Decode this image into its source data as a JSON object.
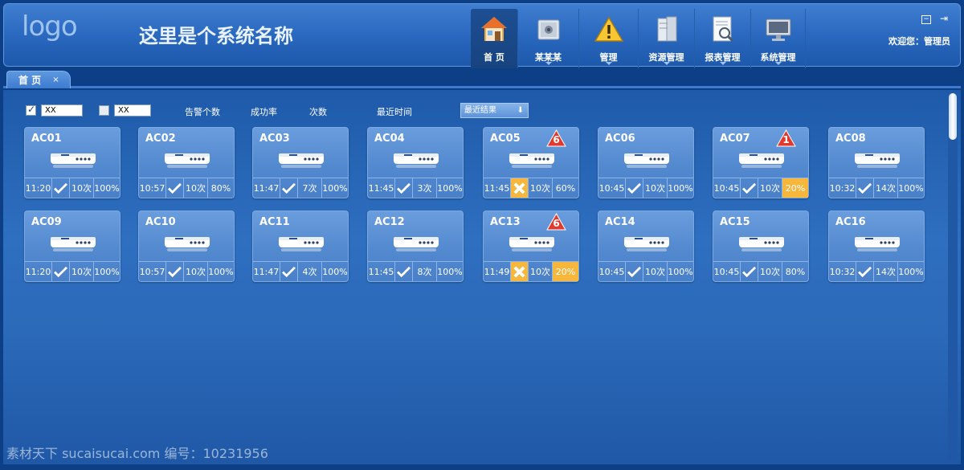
{
  "header": {
    "logo": "logo",
    "system_name": "这里是个系统名称",
    "welcome": "欢迎您：管理员",
    "nav": [
      {
        "label": "首 页",
        "icon": "home-icon",
        "active": true,
        "arrow": false
      },
      {
        "label": "某某某",
        "icon": "safe-icon",
        "active": false,
        "arrow": true
      },
      {
        "label": "管理",
        "icon": "warning-icon",
        "active": false,
        "arrow": true
      },
      {
        "label": "资源管理",
        "icon": "server-icon",
        "active": false,
        "arrow": true
      },
      {
        "label": "报表管理",
        "icon": "report-search-icon",
        "active": false,
        "arrow": true
      },
      {
        "label": "系统管理",
        "icon": "monitor-icon",
        "active": false,
        "arrow": true
      }
    ]
  },
  "tabs": [
    {
      "label": "首 页",
      "close": "×"
    }
  ],
  "filters": {
    "check1": {
      "checked": true,
      "value": "XX"
    },
    "check2": {
      "checked": false,
      "value": "XX"
    },
    "labels": [
      "告警个数",
      "成功率",
      "次数",
      "最近时间"
    ],
    "select": "最近结果"
  },
  "colors": {
    "warn": "#f6b73c",
    "alarm": "#e03a2f"
  },
  "cards": [
    {
      "name": "AC01",
      "time": "11:20",
      "ok": true,
      "count": "10次",
      "rate": "100%",
      "alarm": null,
      "rate_warn": false
    },
    {
      "name": "AC02",
      "time": "10:57",
      "ok": true,
      "count": "10次",
      "rate": "80%",
      "alarm": null,
      "rate_warn": false
    },
    {
      "name": "AC03",
      "time": "11:47",
      "ok": true,
      "count": "7次",
      "rate": "100%",
      "alarm": null,
      "rate_warn": false
    },
    {
      "name": "AC04",
      "time": "11:45",
      "ok": true,
      "count": "3次",
      "rate": "100%",
      "alarm": null,
      "rate_warn": false
    },
    {
      "name": "AC05",
      "time": "11:45",
      "ok": false,
      "count": "10次",
      "rate": "60%",
      "alarm": "6",
      "rate_warn": false
    },
    {
      "name": "AC06",
      "time": "10:45",
      "ok": true,
      "count": "10次",
      "rate": "100%",
      "alarm": null,
      "rate_warn": false
    },
    {
      "name": "AC07",
      "time": "10:45",
      "ok": true,
      "count": "10次",
      "rate": "20%",
      "alarm": "1",
      "rate_warn": true
    },
    {
      "name": "AC08",
      "time": "10:32",
      "ok": true,
      "count": "14次",
      "rate": "100%",
      "alarm": null,
      "rate_warn": false
    },
    {
      "name": "AC09",
      "time": "11:20",
      "ok": true,
      "count": "10次",
      "rate": "100%",
      "alarm": null,
      "rate_warn": false
    },
    {
      "name": "AC10",
      "time": "10:57",
      "ok": true,
      "count": "10次",
      "rate": "100%",
      "alarm": null,
      "rate_warn": false
    },
    {
      "name": "AC11",
      "time": "11:47",
      "ok": true,
      "count": "4次",
      "rate": "100%",
      "alarm": null,
      "rate_warn": false
    },
    {
      "name": "AC12",
      "time": "11:45",
      "ok": true,
      "count": "8次",
      "rate": "100%",
      "alarm": null,
      "rate_warn": false
    },
    {
      "name": "AC13",
      "time": "11:49",
      "ok": false,
      "count": "10次",
      "rate": "20%",
      "alarm": "6",
      "rate_warn": true
    },
    {
      "name": "AC14",
      "time": "10:45",
      "ok": true,
      "count": "10次",
      "rate": "100%",
      "alarm": null,
      "rate_warn": false
    },
    {
      "name": "AC15",
      "time": "10:45",
      "ok": true,
      "count": "10次",
      "rate": "80%",
      "alarm": null,
      "rate_warn": false
    },
    {
      "name": "AC16",
      "time": "10:32",
      "ok": true,
      "count": "14次",
      "rate": "100%",
      "alarm": null,
      "rate_warn": false
    }
  ],
  "watermark": "素材天下 sucaisucai.com   编号：10231956"
}
